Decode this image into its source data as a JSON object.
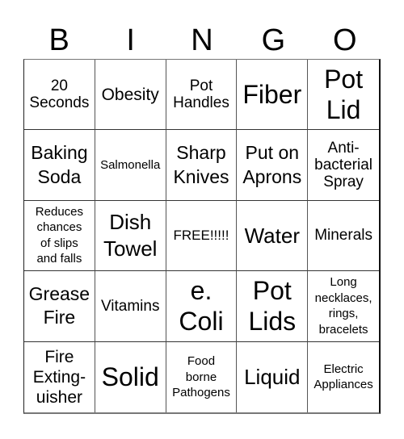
{
  "header": {
    "letters": [
      "B",
      "I",
      "N",
      "G",
      "O"
    ]
  },
  "cells": [
    [
      "20\nSeconds",
      "Obesity",
      "Pot\nHandles",
      "Fiber",
      "Pot\nLid"
    ],
    [
      "Baking\nSoda",
      "Salmonella",
      "Sharp\nKnives",
      "Put on\nAprons",
      "Anti-\nbacterial\nSpray"
    ],
    [
      "Reduces\nchances\nof slips\nand falls",
      "Dish\nTowel",
      "FREE!!!!!",
      "Water",
      "Minerals"
    ],
    [
      "Grease\nFire",
      "Vitamins",
      "e.\nColi",
      "Pot\nLids",
      "Long\nnecklaces,\nrings,\nbracelets"
    ],
    [
      "Fire\nExting-\nuisher",
      "Solid",
      "Food\nborne\nPathogens",
      "Liquid",
      "Electric\nAppliances"
    ]
  ],
  "flat": {
    "r0c0": "20 Seconds",
    "r0c1": "Obesity",
    "r0c2": "Pot Handles",
    "r0c3": "Fiber",
    "r0c4": "Pot Lid",
    "r1c0": "Baking Soda",
    "r1c1": "Salmonella",
    "r1c2": "Sharp Knives",
    "r1c3": "Put on Aprons",
    "r1c4": "Anti- bacterial Spray",
    "r2c0": "Reduces chances of slips and falls",
    "r2c1": "Dish Towel",
    "r2c2": "FREE!!!!!",
    "r2c3": "Water",
    "r2c4": "Minerals",
    "r3c0": "Grease Fire",
    "r3c1": "Vitamins",
    "r3c2": "e. Coli",
    "r3c3": "Pot Lids",
    "r3c4": "Long necklaces, rings, bracelets",
    "r4c0": "Fire Exting- uisher",
    "r4c1": "Solid",
    "r4c2": "Food borne Pathogens",
    "r4c3": "Liquid",
    "r4c4": "Electric Appliances"
  }
}
